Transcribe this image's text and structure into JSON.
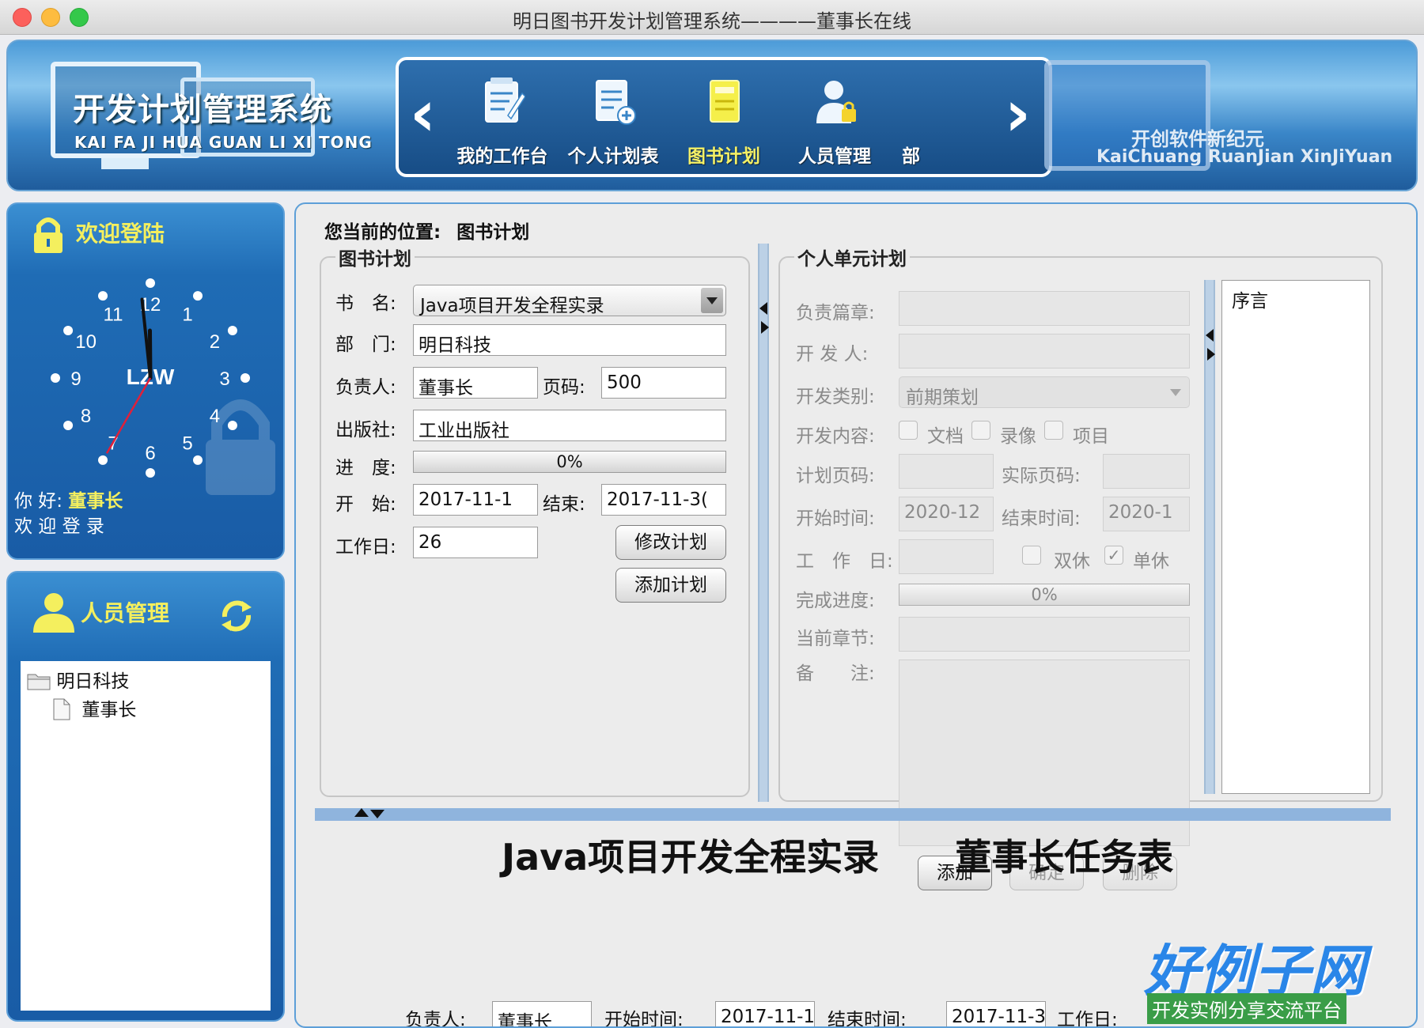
{
  "window": {
    "title": "明日图书开发计划管理系统————董事长在线"
  },
  "header": {
    "logo_title": "开发计划管理系统",
    "logo_subtitle": "KAI FA JI HUA GUAN LI XI TONG",
    "slogan_cn": "开创软件新纪元",
    "slogan_en": "KaiChuang RuanJian XinJiYuan",
    "nav": [
      {
        "label": "我的工作台",
        "icon": "workbench-icon"
      },
      {
        "label": "个人计划表",
        "icon": "personal-plan-icon"
      },
      {
        "label": "图书计划",
        "icon": "book-plan-icon",
        "active": true
      },
      {
        "label": "人员管理",
        "icon": "staff-lock-icon"
      },
      {
        "label": "部"
      }
    ],
    "active_color": "#f4f066"
  },
  "welcome": {
    "title": "欢迎登陆",
    "clock_brand": "LZW",
    "clock_time": {
      "hour": 11,
      "minute": 59,
      "second": 35
    },
    "hello_prefix": "你 好:",
    "user": "董事长",
    "hello_line2": "欢 迎 登 录"
  },
  "staff": {
    "title": "人员管理",
    "tree": [
      {
        "label": "明日科技",
        "icon": "folder-icon"
      },
      {
        "label": "董事长",
        "icon": "file-icon"
      }
    ]
  },
  "main": {
    "location_label": "您当前的位置:",
    "location": "图书计划",
    "book_plan": {
      "legend": "图书计划",
      "book_name_label": "书　名:",
      "book_name": "Java项目开发全程实录",
      "dept_label": "部　门:",
      "dept": "明日科技",
      "owner_label": "负责人:",
      "owner": "董事长",
      "pages_label": "页码:",
      "pages": "500",
      "publisher_label": "出版社:",
      "publisher": "工业出版社",
      "progress_label": "进　度:",
      "progress_text": "0%",
      "progress": 0,
      "start_label": "开　始:",
      "start": "2017-11-1",
      "end_label": "结束:",
      "end": "2017-11-3(",
      "workdays_label": "工作日:",
      "workdays": "26",
      "modify_btn": "修改计划",
      "add_btn": "添加计划"
    },
    "unit_plan": {
      "legend": "个人单元计划",
      "chapter_label": "负责篇章:",
      "developer_label": "开 发 人:",
      "category_label": "开发类别:",
      "category": "前期策划",
      "content_label": "开发内容:",
      "content_opts": [
        "文档",
        "录像",
        "项目"
      ],
      "plan_pages_label": "计划页码:",
      "actual_pages_label": "实际页码:",
      "start_label": "开始时间:",
      "start": "2020-12",
      "end_label": "结束时间:",
      "end": "2020-1",
      "workdays_label": "工　作　日:",
      "double_rest": "双休",
      "single_rest": "单休",
      "single_check": "✓",
      "progress_label": "完成进度:",
      "progress_text": "0%",
      "progress": 0,
      "current_chapter_label": "当前章节:",
      "note_label": "备　　注:",
      "add_btn": "添加",
      "confirm_btn": "确定",
      "delete_btn": "删除"
    },
    "chapter_list": [
      "序言"
    ],
    "bottom_title": "Java项目开发全程实录",
    "bottom_title2": "董事长任务表",
    "bottom_row": [
      "负责人:",
      "董事长",
      "开始时间:",
      "2017-11-1",
      "结束时间:",
      "2017-11-3",
      "工作日:"
    ]
  },
  "watermark": {
    "brand": "好例子网",
    "tagline": "开发实例分享交流平台"
  },
  "colors": {
    "header_blue": "#3a86c8",
    "panel_blue": "#1f6cb5",
    "highlight_yellow": "#f4ef5e",
    "progress_fill": "#6aa3dd"
  }
}
